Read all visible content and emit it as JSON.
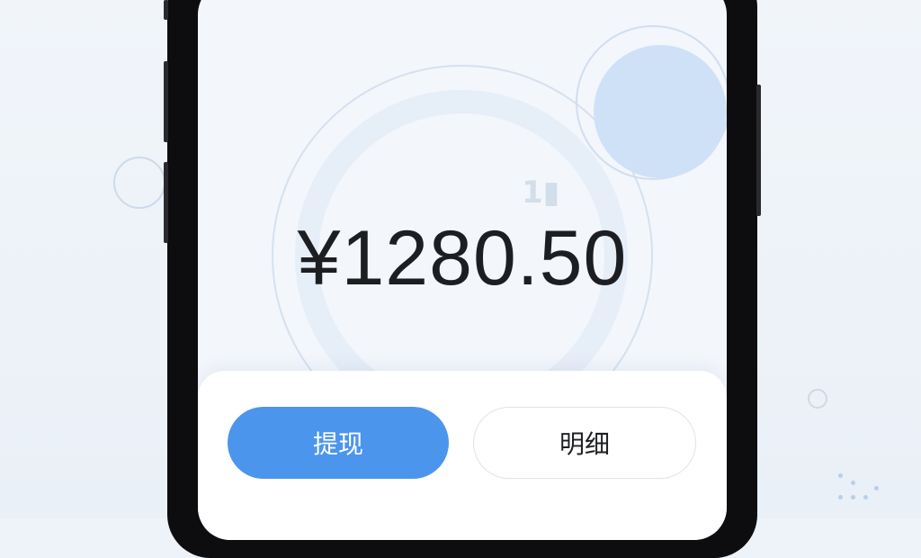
{
  "wallet": {
    "balance": "¥1280.50"
  },
  "actions": {
    "withdraw_label": "提现",
    "details_label": "明细"
  },
  "colors": {
    "primary_button": "#4c95ec",
    "amount_text": "#1d1e21",
    "background": "#eef3f9"
  }
}
